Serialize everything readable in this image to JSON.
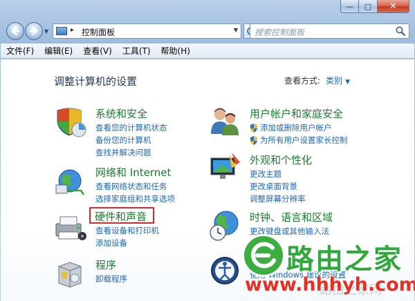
{
  "window": {
    "caption": {
      "min_glyph": "—",
      "max_glyph": "□",
      "close_glyph": "✕"
    }
  },
  "address": {
    "path": "控制面板",
    "separator": "▸"
  },
  "search": {
    "placeholder": "搜索控制面板"
  },
  "menu": [
    "文件(F)",
    "编辑(E)",
    "查看(V)",
    "工具(T)",
    "帮助(H)"
  ],
  "main": {
    "title": "调整计算机的设置",
    "view_by_label": "查看方式:",
    "view_by_value": "类别"
  },
  "categories": {
    "system": {
      "title": "系统和安全",
      "links": [
        "查看您的计算机状态",
        "备份您的计算机",
        "查找并解决问题"
      ]
    },
    "network": {
      "title": "网络和 Internet",
      "links": [
        "查看网络状态和任务",
        "选择家庭组和共享选项"
      ]
    },
    "hardware": {
      "title": "硬件和声音",
      "links": [
        "查看设备和打印机",
        "添加设备"
      ]
    },
    "programs": {
      "title": "程序",
      "links": [
        "卸载程序"
      ]
    },
    "users": {
      "title": "用户帐户和家庭安全",
      "links": [
        "添加或删除用户帐户",
        "为所有用户设置家长控制"
      ]
    },
    "appearance": {
      "title": "外观和个性化",
      "links": [
        "更改主题",
        "更改桌面背景",
        "调整屏幕分辨率"
      ]
    },
    "clock": {
      "title": "时钟、语言和区域",
      "links": [
        "更改键盘或其他输入法"
      ]
    },
    "ease": {
      "links": [
        "使用 Windows 建议的设置"
      ]
    }
  },
  "watermark": {
    "brand": "路由之家",
    "url": "www.hhhyh.com",
    "faint": "路由之家网"
  }
}
